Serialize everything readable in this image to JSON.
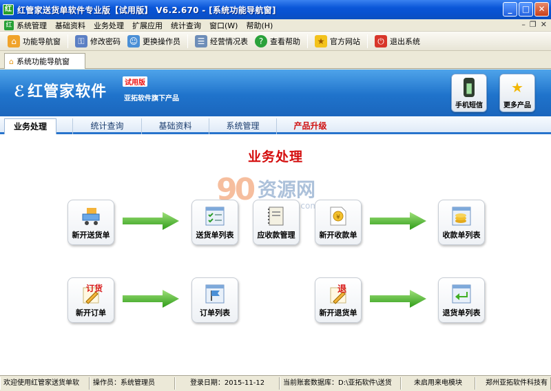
{
  "window": {
    "title": "红管家送货单软件专业版【试用版】 V6.2.670 - [系统功能导航窗]"
  },
  "menu": {
    "items": [
      "系统管理",
      "基础资料",
      "业务处理",
      "扩展应用",
      "统计查询",
      "窗口(W)",
      "帮助(H)"
    ]
  },
  "toolbar": {
    "items": [
      {
        "label": "功能导航窗",
        "icon": "home-icon"
      },
      {
        "label": "修改密码",
        "icon": "users-key-icon"
      },
      {
        "label": "更换操作员",
        "icon": "user-swap-icon"
      },
      {
        "label": "经营情况表",
        "icon": "report-icon"
      },
      {
        "label": "查看帮助",
        "icon": "help-icon"
      },
      {
        "label": "官方网站",
        "icon": "star-icon"
      },
      {
        "label": "退出系统",
        "icon": "power-icon"
      }
    ]
  },
  "doc_tab": {
    "label": "系统功能导航窗"
  },
  "banner": {
    "logo": "红管家软件",
    "trial": "试用版",
    "sub": "亚拓软件旗下产品",
    "sms_label": "手机短信",
    "more_label": "更多产品"
  },
  "nav_tabs": [
    "业务处理",
    "统计查询",
    "基础资料",
    "系统管理",
    "产品升级"
  ],
  "section_title": "业务处理",
  "watermark": {
    "num": "90",
    "text": "资源网",
    "sub": "90ziyuan.com"
  },
  "functions": {
    "new_delivery": "新开送货单",
    "delivery_list": "送货单列表",
    "receivables": "应收款管理",
    "new_receipt": "新开收款单",
    "receipt_list": "收款单列表",
    "new_order": "新开订单",
    "order_badge": "订货",
    "order_list": "订单列表",
    "new_return": "新开退货单",
    "return_badge": "退",
    "return_list": "退货单列表"
  },
  "status": {
    "welcome": "欢迎使用红管家送货单软",
    "operator": "操作员：系统管理员",
    "login_date": "登录日期：2015-11-12",
    "db": "当前账套数据库：D:\\亚拓软件\\送货",
    "caller_id": "未启用来电模块",
    "company": "郑州亚拓软件科技有"
  },
  "colors": {
    "title_red": "#d40d0d",
    "banner_blue": "#1f73cb",
    "arrow_green": "#3fae22"
  }
}
